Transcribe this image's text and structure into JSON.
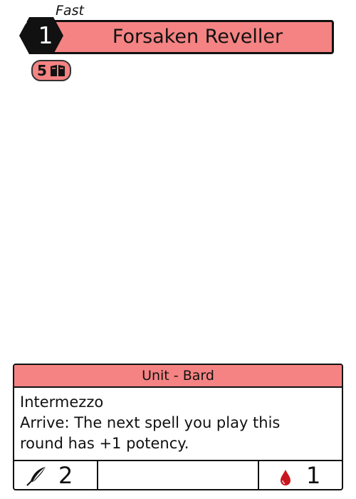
{
  "card": {
    "speed": "Fast",
    "cost": "1",
    "name": "Forsaken Reveller",
    "deck_count": "5",
    "type_line": "Unit - Bard",
    "rules": [
      "Intermezzo",
      "Arrive: The next spell you play this",
      "round has +1 potency."
    ],
    "attack": "2",
    "health": "1"
  },
  "icons": {
    "speed": "lightning-bolt-icon",
    "deck": "book-icon",
    "attack": "quill-icon",
    "health": "blood-drop-icon"
  },
  "colors": {
    "accent": "#f58383",
    "cost_hex": "#111111",
    "blood": "#c8161e"
  }
}
